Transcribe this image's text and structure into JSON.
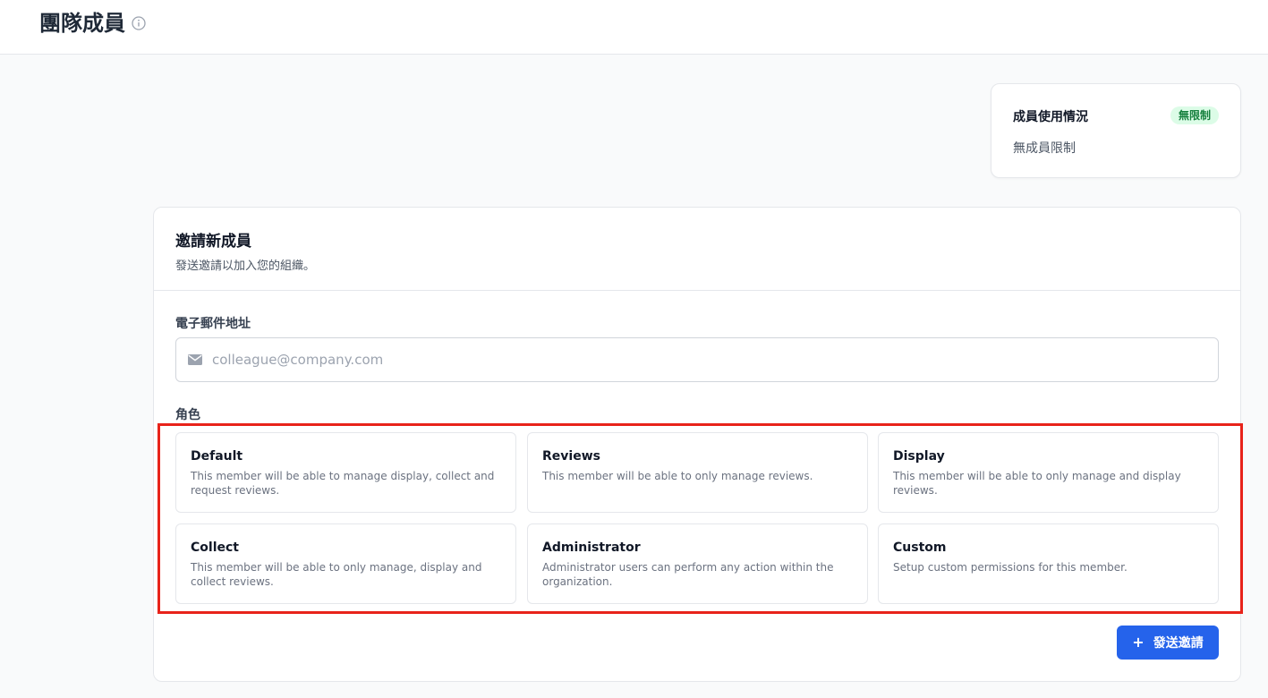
{
  "header": {
    "title": "團隊成員",
    "info_icon": "info-circle-icon"
  },
  "usage": {
    "title": "成員使用情況",
    "badge": "無限制",
    "description": "無成員限制"
  },
  "invite": {
    "title": "邀請新成員",
    "subtitle": "發送邀請以加入您的組織。",
    "email_label": "電子郵件地址",
    "email_icon": "mail-icon",
    "email_placeholder": "colleague@company.com",
    "email_value": "",
    "role_label": "角色",
    "roles": [
      {
        "name": "Default",
        "description": "This member will be able to manage display, collect and request reviews."
      },
      {
        "name": "Reviews",
        "description": "This member will be able to only manage reviews."
      },
      {
        "name": "Display",
        "description": "This member will be able to only manage and display reviews."
      },
      {
        "name": "Collect",
        "description": "This member will be able to only manage, display and collect reviews."
      },
      {
        "name": "Administrator",
        "description": "Administrator users can perform any action within the organization."
      },
      {
        "name": "Custom",
        "description": "Setup custom permissions for this member."
      }
    ],
    "send_icon": "+",
    "send_label": "發送邀請"
  },
  "colors": {
    "primary": "#2563eb",
    "badge_bg": "#dcfce7",
    "badge_text": "#15803d",
    "highlight": "#e8231a"
  }
}
